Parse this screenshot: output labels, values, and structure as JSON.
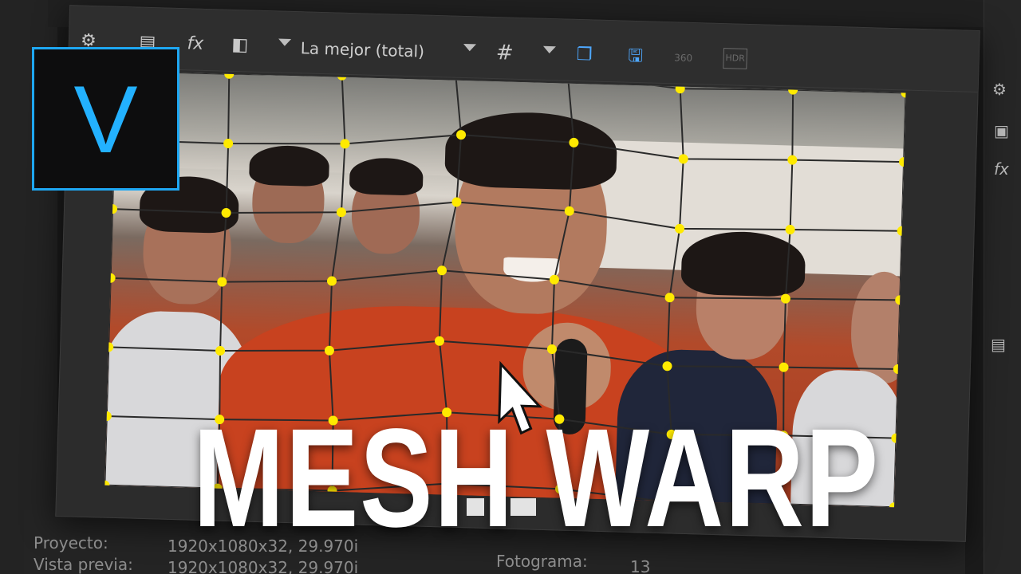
{
  "toolbar": {
    "quality_label": "La mejor (total)",
    "icons": [
      "gear-icon",
      "split-screen-icon",
      "fx-icon",
      "overlay-icon",
      "dropdown-caret-icon",
      "grid-icon",
      "copy-frame-icon",
      "save-frame-icon",
      "360-icon",
      "hdr-icon"
    ],
    "hdr_label": "HDR",
    "deg360_label": "360"
  },
  "logo": {
    "letter": "V",
    "accent": "#1ea7f2"
  },
  "title": "MESH WARP",
  "info": {
    "project_label": "Proyecto:",
    "project_value": "1920x1080x32, 29.970i",
    "preview_label": "Vista previa:",
    "preview_value": "1920x1080x32, 29.970i",
    "frame_label": "Fotograma:",
    "frame_value": "13"
  },
  "right_panel": {
    "fx_label": "fx"
  },
  "colors": {
    "mesh_point": "#ffea00",
    "mesh_line": "#2a2a2a"
  }
}
